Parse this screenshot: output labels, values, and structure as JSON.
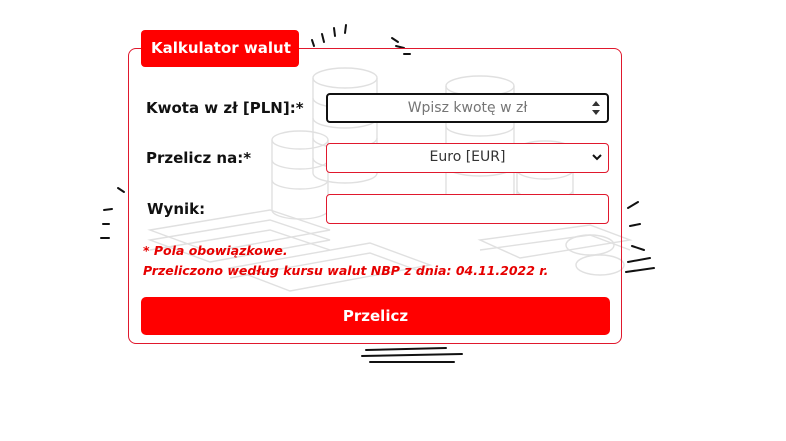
{
  "calculator": {
    "title": "Kalkulator walut",
    "amount_label": "Kwota w zł [PLN]:*",
    "amount_placeholder": "Wpisz kwotę w zł",
    "amount_value": "",
    "currency_label": "Przelicz na:*",
    "currency_selected": "Euro [EUR]",
    "result_label": "Wynik:",
    "result_value": "",
    "required_note": "* Pola obowiązkowe.",
    "rate_note": "Przeliczono według kursu walut NBP z dnia: 04.11.2022 r.",
    "submit_label": "Przelicz"
  },
  "colors": {
    "accent": "#ff0000",
    "border": "#e0182d",
    "note_text": "#e60000"
  },
  "icons": {
    "spinner": "number-spinner-icon",
    "dropdown": "chevron-down-icon",
    "background": "coins-and-banknotes-sketch"
  }
}
